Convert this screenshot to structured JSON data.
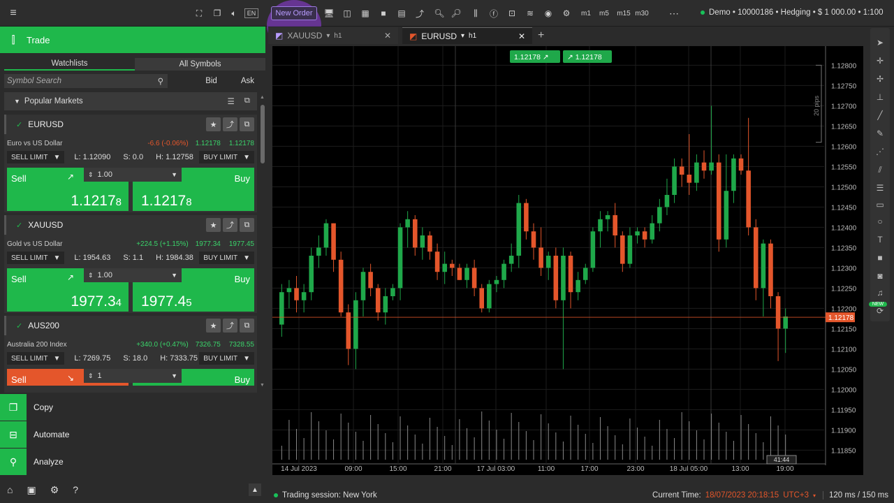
{
  "topbar": {
    "new_order": "New Order",
    "lang": "EN",
    "timeframes": [
      "m1",
      "m5",
      "m15",
      "m30"
    ],
    "account": "Demo • 10000186 • Hedging • $ 1 000.00 • 1:100"
  },
  "left": {
    "trade_title": "Trade",
    "tabs": [
      "Watchlists",
      "All Symbols"
    ],
    "search_placeholder": "Symbol Search",
    "bid_label": "Bid",
    "ask_label": "Ask",
    "popular": "Popular Markets",
    "cards": [
      {
        "symbol": "EURUSD",
        "desc": "Euro vs US Dollar",
        "change": "-6.6 (-0.06%)",
        "change_color": "#e4562b",
        "bid": "1.12178",
        "ask": "1.12178",
        "sell_limit": "SELL LIMIT",
        "low": "L: 1.12090",
        "spread": "S: 0.0",
        "high": "H: 1.12758",
        "buy_limit": "BUY LIMIT",
        "sell_label": "Sell",
        "buy_label": "Buy",
        "qty": "1.00",
        "sell_price": "1.1217",
        "sell_pip": "8",
        "buy_price": "1.1217",
        "buy_pip": "8",
        "sell_red": false
      },
      {
        "symbol": "XAUUSD",
        "desc": "Gold vs US Dollar",
        "change": "+224.5 (+1.15%)",
        "change_color": "#3ad46a",
        "bid": "1977.34",
        "ask": "1977.45",
        "sell_limit": "SELL LIMIT",
        "low": "L: 1954.63",
        "spread": "S: 1.1",
        "high": "H: 1984.38",
        "buy_limit": "BUY LIMIT",
        "sell_label": "Sell",
        "buy_label": "Buy",
        "qty": "1.00",
        "sell_price": "1977.3",
        "sell_pip": "4",
        "buy_price": "1977.4",
        "buy_pip": "5",
        "sell_red": false
      },
      {
        "symbol": "AUS200",
        "desc": "Australia 200 Index",
        "change": "+340.0 (+0.47%)",
        "change_color": "#3ad46a",
        "bid": "7326.75",
        "ask": "7328.55",
        "sell_limit": "SELL LIMIT",
        "low": "L: 7269.75",
        "spread": "S: 18.0",
        "high": "H: 7333.75",
        "buy_limit": "BUY LIMIT",
        "sell_label": "Sell",
        "buy_label": "Buy",
        "qty": "1",
        "sell_price": "",
        "sell_pip": "",
        "buy_price": "",
        "buy_pip": "",
        "sell_red": true
      }
    ],
    "nav": [
      "Copy",
      "Automate",
      "Analyze"
    ]
  },
  "chart": {
    "tabs": [
      {
        "symbol": "XAUUSD",
        "tf": "h1"
      },
      {
        "symbol": "EURUSD",
        "tf": "h1"
      }
    ],
    "quick_sell": "1.12178",
    "quick_buy": "1.12178",
    "pips_label": "20 pips",
    "current_price": "1.12178",
    "new_badge": "NEW",
    "countdown": "41:44",
    "price_ticks": [
      "1.12800",
      "1.12750",
      "1.12700",
      "1.12650",
      "1.12600",
      "1.12550",
      "1.12500",
      "1.12450",
      "1.12400",
      "1.12350",
      "1.12300",
      "1.12250",
      "1.12200",
      "1.12150",
      "1.12100",
      "1.12050",
      "1.12000",
      "1.11950",
      "1.11900",
      "1.11850"
    ],
    "time_ticks": [
      "14 Jul 2023",
      "09:00",
      "15:00",
      "21:00",
      "17 Jul 03:00",
      "11:00",
      "17:00",
      "23:00",
      "18 Jul 05:00",
      "13:00",
      "19:00"
    ]
  },
  "chart_data": {
    "type": "candlestick",
    "symbol": "EURUSD",
    "timeframe": "h1",
    "ylim": [
      1.1183,
      1.1283
    ],
    "candles": [
      {
        "o": 1.1216,
        "h": 1.1226,
        "l": 1.1213,
        "c": 1.1224
      },
      {
        "o": 1.1224,
        "h": 1.1227,
        "l": 1.122,
        "c": 1.1225
      },
      {
        "o": 1.1225,
        "h": 1.1228,
        "l": 1.1219,
        "c": 1.1222
      },
      {
        "o": 1.1222,
        "h": 1.1226,
        "l": 1.1219,
        "c": 1.1224
      },
      {
        "o": 1.1224,
        "h": 1.1235,
        "l": 1.1222,
        "c": 1.1233
      },
      {
        "o": 1.1233,
        "h": 1.1238,
        "l": 1.123,
        "c": 1.1235
      },
      {
        "o": 1.1235,
        "h": 1.1242,
        "l": 1.1233,
        "c": 1.1241
      },
      {
        "o": 1.1241,
        "h": 1.1241,
        "l": 1.1229,
        "c": 1.1232
      },
      {
        "o": 1.1232,
        "h": 1.1234,
        "l": 1.1218,
        "c": 1.1219
      },
      {
        "o": 1.1219,
        "h": 1.1221,
        "l": 1.1206,
        "c": 1.121
      },
      {
        "o": 1.121,
        "h": 1.1224,
        "l": 1.1205,
        "c": 1.1222
      },
      {
        "o": 1.1222,
        "h": 1.123,
        "l": 1.1218,
        "c": 1.1229
      },
      {
        "o": 1.1229,
        "h": 1.1231,
        "l": 1.1223,
        "c": 1.1225
      },
      {
        "o": 1.1225,
        "h": 1.1226,
        "l": 1.1217,
        "c": 1.1219
      },
      {
        "o": 1.1219,
        "h": 1.1225,
        "l": 1.1216,
        "c": 1.1223
      },
      {
        "o": 1.1223,
        "h": 1.1226,
        "l": 1.1222,
        "c": 1.1225
      },
      {
        "o": 1.1225,
        "h": 1.1241,
        "l": 1.1222,
        "c": 1.124
      },
      {
        "o": 1.124,
        "h": 1.1244,
        "l": 1.1235,
        "c": 1.1242
      },
      {
        "o": 1.1242,
        "h": 1.1243,
        "l": 1.1233,
        "c": 1.1235
      },
      {
        "o": 1.1235,
        "h": 1.124,
        "l": 1.1232,
        "c": 1.1238
      },
      {
        "o": 1.1238,
        "h": 1.1239,
        "l": 1.1232,
        "c": 1.1234
      },
      {
        "o": 1.1234,
        "h": 1.1236,
        "l": 1.1227,
        "c": 1.1229
      },
      {
        "o": 1.1229,
        "h": 1.1234,
        "l": 1.1226,
        "c": 1.1231
      },
      {
        "o": 1.1231,
        "h": 1.1232,
        "l": 1.1228,
        "c": 1.123
      },
      {
        "o": 1.123,
        "h": 1.1231,
        "l": 1.1227,
        "c": 1.1227
      },
      {
        "o": 1.1227,
        "h": 1.1231,
        "l": 1.1225,
        "c": 1.123
      },
      {
        "o": 1.123,
        "h": 1.1232,
        "l": 1.1223,
        "c": 1.1225
      },
      {
        "o": 1.1225,
        "h": 1.1226,
        "l": 1.1219,
        "c": 1.122
      },
      {
        "o": 1.122,
        "h": 1.1227,
        "l": 1.1219,
        "c": 1.1226
      },
      {
        "o": 1.1226,
        "h": 1.1228,
        "l": 1.1224,
        "c": 1.1227
      },
      {
        "o": 1.1227,
        "h": 1.1232,
        "l": 1.1225,
        "c": 1.1231
      },
      {
        "o": 1.1231,
        "h": 1.1236,
        "l": 1.1229,
        "c": 1.1233
      },
      {
        "o": 1.1233,
        "h": 1.1248,
        "l": 1.123,
        "c": 1.1246
      },
      {
        "o": 1.1246,
        "h": 1.1247,
        "l": 1.1237,
        "c": 1.1239
      },
      {
        "o": 1.1239,
        "h": 1.1241,
        "l": 1.1232,
        "c": 1.1235
      },
      {
        "o": 1.1235,
        "h": 1.124,
        "l": 1.1228,
        "c": 1.123
      },
      {
        "o": 1.123,
        "h": 1.1234,
        "l": 1.1227,
        "c": 1.1233
      },
      {
        "o": 1.1233,
        "h": 1.1235,
        "l": 1.122,
        "c": 1.1222
      },
      {
        "o": 1.1222,
        "h": 1.1235,
        "l": 1.1205,
        "c": 1.1233
      },
      {
        "o": 1.1233,
        "h": 1.1234,
        "l": 1.122,
        "c": 1.1224
      },
      {
        "o": 1.1224,
        "h": 1.1229,
        "l": 1.1222,
        "c": 1.1227
      },
      {
        "o": 1.1227,
        "h": 1.1231,
        "l": 1.1226,
        "c": 1.123
      },
      {
        "o": 1.123,
        "h": 1.124,
        "l": 1.1229,
        "c": 1.1239
      },
      {
        "o": 1.1239,
        "h": 1.1244,
        "l": 1.1235,
        "c": 1.1242
      },
      {
        "o": 1.1242,
        "h": 1.1244,
        "l": 1.1239,
        "c": 1.1243
      },
      {
        "o": 1.1243,
        "h": 1.1246,
        "l": 1.1235,
        "c": 1.1238
      },
      {
        "o": 1.1238,
        "h": 1.1239,
        "l": 1.1229,
        "c": 1.1231
      },
      {
        "o": 1.1231,
        "h": 1.124,
        "l": 1.123,
        "c": 1.1238
      },
      {
        "o": 1.1238,
        "h": 1.124,
        "l": 1.1236,
        "c": 1.1239
      },
      {
        "o": 1.1239,
        "h": 1.124,
        "l": 1.1235,
        "c": 1.1237
      },
      {
        "o": 1.1237,
        "h": 1.1243,
        "l": 1.1236,
        "c": 1.1241
      },
      {
        "o": 1.1241,
        "h": 1.1247,
        "l": 1.1239,
        "c": 1.1245
      },
      {
        "o": 1.1245,
        "h": 1.1252,
        "l": 1.1243,
        "c": 1.1248
      },
      {
        "o": 1.1248,
        "h": 1.1257,
        "l": 1.1246,
        "c": 1.1255
      },
      {
        "o": 1.1255,
        "h": 1.1257,
        "l": 1.125,
        "c": 1.1253
      },
      {
        "o": 1.1253,
        "h": 1.1263,
        "l": 1.1248,
        "c": 1.1251
      },
      {
        "o": 1.1251,
        "h": 1.1258,
        "l": 1.1249,
        "c": 1.1256
      },
      {
        "o": 1.1256,
        "h": 1.1259,
        "l": 1.1252,
        "c": 1.1254
      },
      {
        "o": 1.1254,
        "h": 1.127,
        "l": 1.1253,
        "c": 1.1256
      },
      {
        "o": 1.1256,
        "h": 1.1258,
        "l": 1.1234,
        "c": 1.1237
      },
      {
        "o": 1.1237,
        "h": 1.1258,
        "l": 1.1235,
        "c": 1.1249
      },
      {
        "o": 1.1249,
        "h": 1.1258,
        "l": 1.1246,
        "c": 1.1257
      },
      {
        "o": 1.1257,
        "h": 1.1258,
        "l": 1.1253,
        "c": 1.1254
      },
      {
        "o": 1.1254,
        "h": 1.1267,
        "l": 1.1238,
        "c": 1.124
      },
      {
        "o": 1.124,
        "h": 1.1242,
        "l": 1.1222,
        "c": 1.1225
      },
      {
        "o": 1.1225,
        "h": 1.1237,
        "l": 1.1218,
        "c": 1.1236
      },
      {
        "o": 1.1236,
        "h": 1.1237,
        "l": 1.122,
        "c": 1.1223
      },
      {
        "o": 1.1223,
        "h": 1.1224,
        "l": 1.1207,
        "c": 1.1215
      },
      {
        "o": 1.1215,
        "h": 1.122,
        "l": 1.1209,
        "c": 1.1218
      }
    ],
    "current_price": 1.12178
  }
}
